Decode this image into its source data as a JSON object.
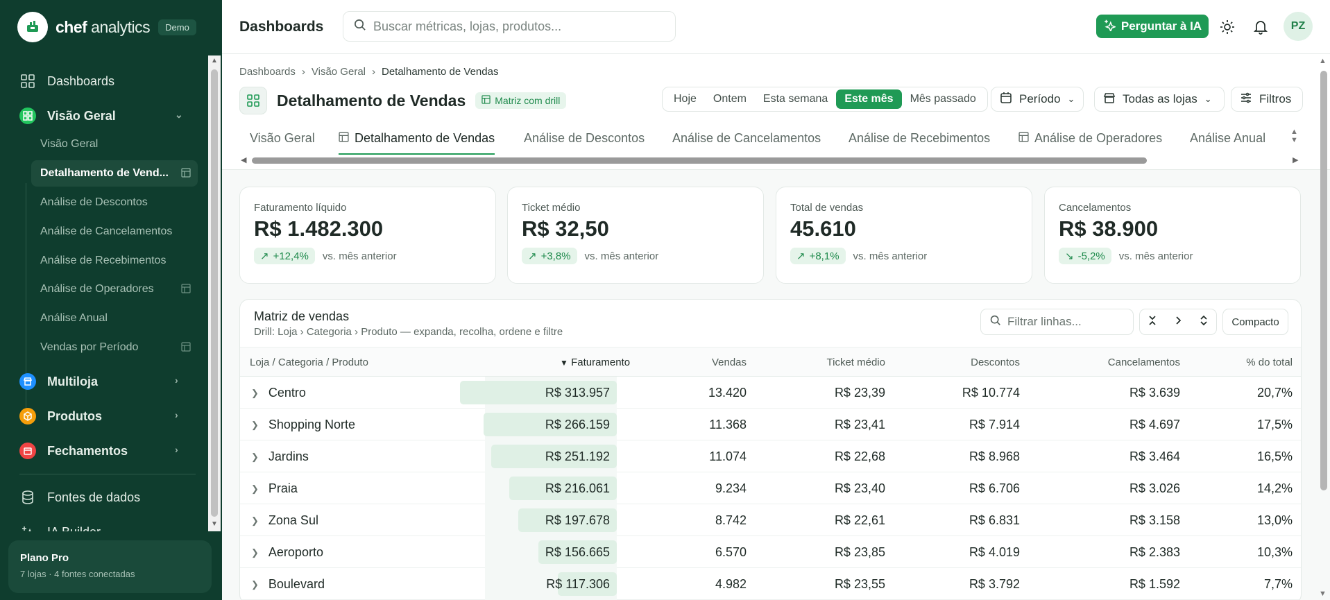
{
  "sidebar": {
    "brand_name_bold": "chef",
    "brand_name_light": " analytics",
    "demo_badge": "Demo",
    "nav": [
      {
        "label": "Dashboards"
      },
      {
        "label": "Visão Geral"
      },
      {
        "label": "Multiloja"
      },
      {
        "label": "Produtos"
      },
      {
        "label": "Fechamentos"
      },
      {
        "label": "Fontes de dados"
      },
      {
        "label": "IA Builder"
      }
    ],
    "sub_items": [
      {
        "label": "Visão Geral"
      },
      {
        "label": "Detalhamento de Vend..."
      },
      {
        "label": "Análise de Descontos"
      },
      {
        "label": "Análise de Cancelamentos"
      },
      {
        "label": "Análise de Recebimentos"
      },
      {
        "label": "Análise de Operadores"
      },
      {
        "label": "Análise Anual"
      },
      {
        "label": "Vendas por Período"
      }
    ],
    "plan": {
      "title": "Plano Pro",
      "subtitle": "7 lojas · 4 fontes conectadas"
    },
    "colors": {
      "multiloja": "#1e90ff",
      "produtos": "#f59e0b",
      "fechamentos": "#ef4444",
      "visao_geral": "#22c55e"
    }
  },
  "topbar": {
    "title": "Dashboards",
    "search_placeholder": "Buscar métricas, lojas, produtos...",
    "ai_button": "Perguntar à IA",
    "avatar_initials": "PZ"
  },
  "breadcrumb": [
    "Dashboards",
    "Visão Geral",
    "Detalhamento de Vendas"
  ],
  "page": {
    "title": "Detalhamento de Vendas",
    "badge": "Matriz com drill",
    "periods": [
      "Hoje",
      "Ontem",
      "Esta semana",
      "Este mês",
      "Mês passado"
    ],
    "active_period": "Este mês",
    "period_dropdown": "Período",
    "stores_dropdown": "Todas as lojas",
    "filters_button": "Filtros"
  },
  "tabs": [
    {
      "label": "Visão Geral",
      "icon": false
    },
    {
      "label": "Detalhamento de Vendas",
      "icon": true
    },
    {
      "label": "Análise de Descontos",
      "icon": false
    },
    {
      "label": "Análise de Cancelamentos",
      "icon": false
    },
    {
      "label": "Análise de Recebimentos",
      "icon": false
    },
    {
      "label": "Análise de Operadores",
      "icon": true
    },
    {
      "label": "Análise Anual",
      "icon": false
    }
  ],
  "kpis": [
    {
      "label": "Faturamento líquido",
      "value": "R$ 1.482.300",
      "delta": "+12,4%",
      "direction": "up",
      "compare": "vs. mês anterior"
    },
    {
      "label": "Ticket médio",
      "value": "R$ 32,50",
      "delta": "+3,8%",
      "direction": "up",
      "compare": "vs. mês anterior"
    },
    {
      "label": "Total de vendas",
      "value": "45.610",
      "delta": "+8,1%",
      "direction": "up",
      "compare": "vs. mês anterior"
    },
    {
      "label": "Cancelamentos",
      "value": "R$ 38.900",
      "delta": "-5,2%",
      "direction": "down",
      "compare": "vs. mês anterior"
    }
  ],
  "matrix": {
    "title": "Matriz de vendas",
    "subtitle": "Drill: Loja › Categoria › Produto — expanda, recolha, ordene e filtre",
    "filter_placeholder": "Filtrar linhas...",
    "compact_button": "Compacto",
    "columns": [
      "Loja / Categoria / Produto",
      "Faturamento",
      "Vendas",
      "Ticket médio",
      "Descontos",
      "Cancelamentos",
      "% do total"
    ],
    "sort_indicator": "▼",
    "rows": [
      {
        "name": "Centro",
        "faturamento": "R$ 313.957",
        "share": 1.0,
        "vendas": "13.420",
        "ticket": "R$ 23,39",
        "descontos": "R$ 10.774",
        "cancelamentos": "R$ 3.639",
        "pct": "20,7%"
      },
      {
        "name": "Shopping Norte",
        "faturamento": "R$ 266.159",
        "share": 0.848,
        "vendas": "11.368",
        "ticket": "R$ 23,41",
        "descontos": "R$ 7.914",
        "cancelamentos": "R$ 4.697",
        "pct": "17,5%"
      },
      {
        "name": "Jardins",
        "faturamento": "R$ 251.192",
        "share": 0.8,
        "vendas": "11.074",
        "ticket": "R$ 22,68",
        "descontos": "R$ 8.968",
        "cancelamentos": "R$ 3.464",
        "pct": "16,5%"
      },
      {
        "name": "Praia",
        "faturamento": "R$ 216.061",
        "share": 0.688,
        "vendas": "9.234",
        "ticket": "R$ 23,40",
        "descontos": "R$ 6.706",
        "cancelamentos": "R$ 3.026",
        "pct": "14,2%"
      },
      {
        "name": "Zona Sul",
        "faturamento": "R$ 197.678",
        "share": 0.63,
        "vendas": "8.742",
        "ticket": "R$ 22,61",
        "descontos": "R$ 6.831",
        "cancelamentos": "R$ 3.158",
        "pct": "13,0%"
      },
      {
        "name": "Aeroporto",
        "faturamento": "R$ 156.665",
        "share": 0.499,
        "vendas": "6.570",
        "ticket": "R$ 23,85",
        "descontos": "R$ 4.019",
        "cancelamentos": "R$ 2.383",
        "pct": "10,3%"
      },
      {
        "name": "Boulevard",
        "faturamento": "R$ 117.306",
        "share": 0.374,
        "vendas": "4.982",
        "ticket": "R$ 23,55",
        "descontos": "R$ 3.792",
        "cancelamentos": "R$ 1.592",
        "pct": "7,7%"
      }
    ]
  }
}
